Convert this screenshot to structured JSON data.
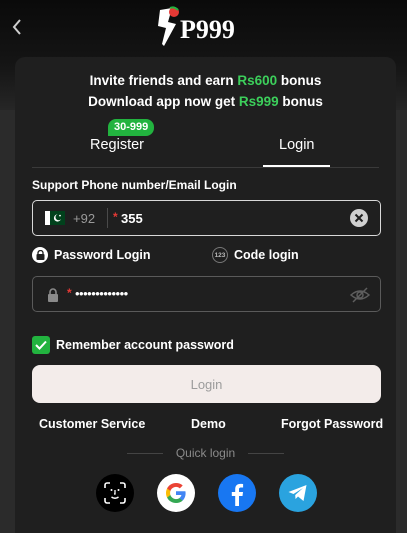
{
  "header": {
    "logo_text": "P999"
  },
  "promo": {
    "line1_prefix": "Invite friends and earn ",
    "line1_amount": "Rs600",
    "line1_suffix": " bonus",
    "line2_prefix": "Download app now get ",
    "line2_amount": "Rs999",
    "line2_suffix": " bonus"
  },
  "tabs": {
    "register_label": "Register",
    "register_badge": "30-999",
    "login_label": "Login",
    "active": "Login"
  },
  "form": {
    "phone_label": "Support Phone number/Email Login",
    "country_code": "+92",
    "phone_value": "355",
    "password_login_label": "Password Login",
    "code_login_label": "Code login",
    "code_icon_text": "123",
    "password_value": "•••••••••••••",
    "remember_label": "Remember account password",
    "remember_checked": true,
    "login_button": "Login"
  },
  "links": {
    "customer_service": "Customer Service",
    "demo": "Demo",
    "forgot_password": "Forgot Password"
  },
  "quick_login": {
    "label": "Quick login",
    "providers": [
      "face-id",
      "google",
      "facebook",
      "telegram"
    ]
  },
  "colors": {
    "accent_green": "#22b33f",
    "highlight_green": "#3ccf5b",
    "required_red": "#e53935",
    "facebook_blue": "#1877f2",
    "telegram_blue": "#2aa3df"
  }
}
